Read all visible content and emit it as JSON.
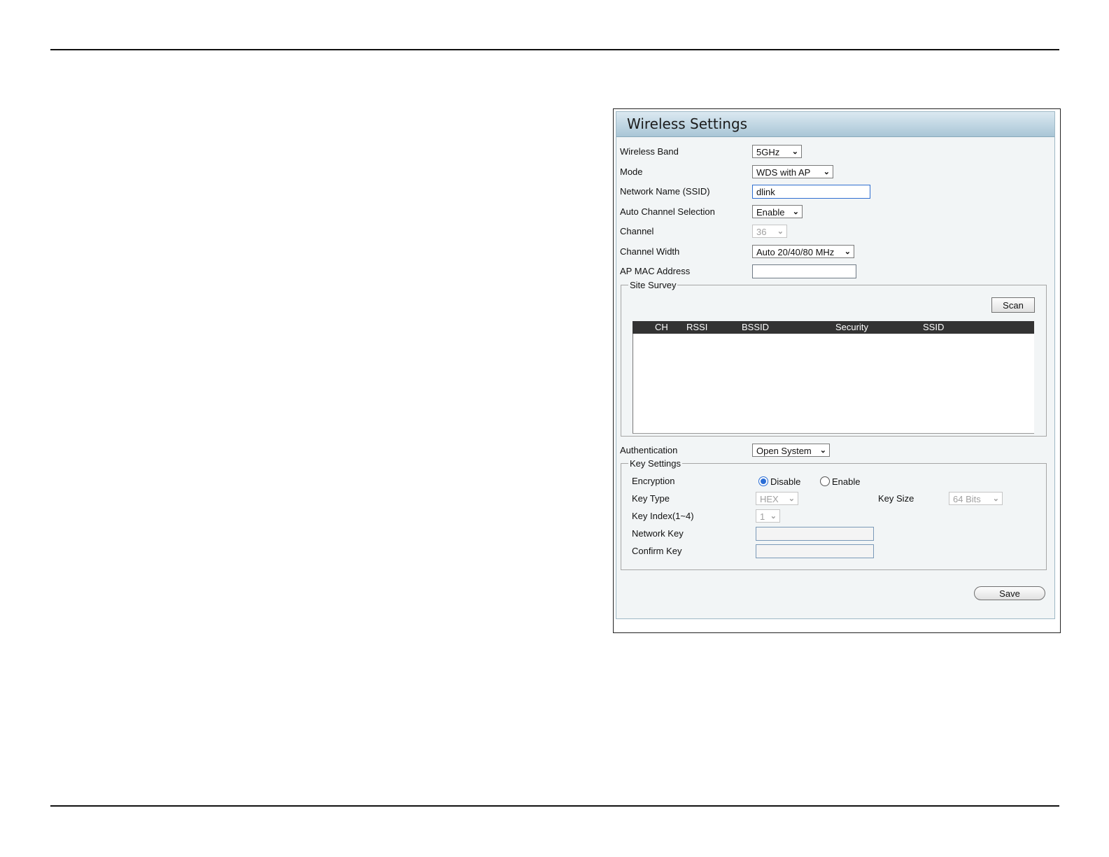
{
  "panel": {
    "title": "Wireless Settings"
  },
  "form": {
    "wireless_band": {
      "label": "Wireless Band",
      "value": "5GHz"
    },
    "mode": {
      "label": "Mode",
      "value": "WDS with AP"
    },
    "ssid": {
      "label": "Network Name (SSID)",
      "value": "dlink"
    },
    "auto_channel": {
      "label": "Auto Channel Selection",
      "value": "Enable"
    },
    "channel": {
      "label": "Channel",
      "value": "36"
    },
    "channel_width": {
      "label": "Channel Width",
      "value": "Auto 20/40/80 MHz"
    },
    "ap_mac": {
      "label": "AP MAC Address",
      "value": ""
    },
    "authentication": {
      "label": "Authentication",
      "value": "Open System"
    }
  },
  "site_survey": {
    "legend": "Site Survey",
    "scan_label": "Scan",
    "columns": [
      "CH",
      "RSSI",
      "BSSID",
      "Security",
      "SSID"
    ]
  },
  "key_settings": {
    "legend": "Key Settings",
    "encryption": {
      "label": "Encryption",
      "option_disable": "Disable",
      "option_enable": "Enable",
      "selected": "Disable"
    },
    "key_type": {
      "label": "Key Type",
      "value": "HEX"
    },
    "key_size": {
      "label": "Key Size",
      "value": "64 Bits"
    },
    "key_index": {
      "label": "Key Index(1~4)",
      "value": "1"
    },
    "network_key": {
      "label": "Network Key",
      "value": ""
    },
    "confirm_key": {
      "label": "Confirm Key",
      "value": ""
    }
  },
  "save_label": "Save",
  "icons": {
    "dropdown": "chevron-down-icon"
  },
  "colors": {
    "header_top": "#dbe9f1",
    "header_bottom": "#a9c6d6",
    "panel_bg": "#f2f5f6",
    "radio_selected": "#2b6ed6"
  }
}
